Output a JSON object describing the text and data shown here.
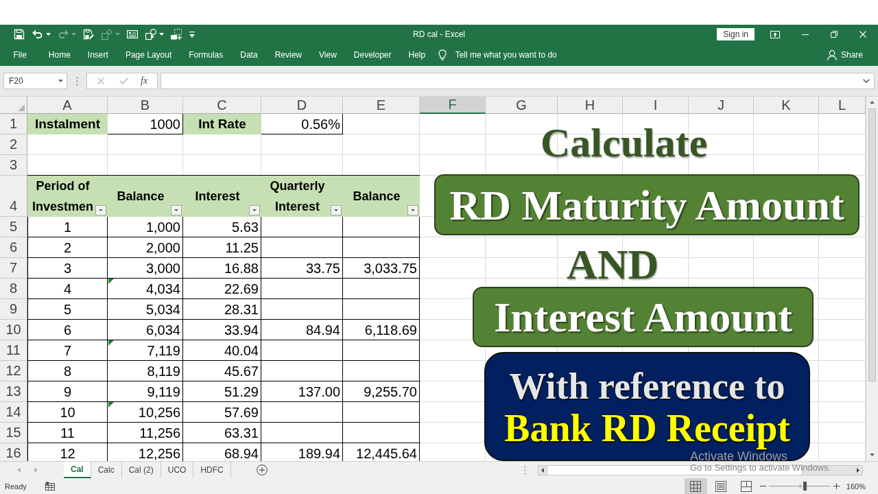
{
  "window": {
    "title": "RD cal - Excel",
    "sign_in": "Sign in"
  },
  "quick_access": [
    {
      "kind": "save",
      "disabled": false,
      "dropdown": false
    },
    {
      "kind": "undo",
      "disabled": false,
      "dropdown": true
    },
    {
      "kind": "redo",
      "disabled": true,
      "dropdown": true
    },
    {
      "kind": "save_edit",
      "disabled": false,
      "dropdown": false
    },
    {
      "kind": "shape_select",
      "disabled": true,
      "dropdown": true
    },
    {
      "kind": "form",
      "disabled": false,
      "dropdown": false
    },
    {
      "kind": "shapes",
      "disabled": false,
      "dropdown": true
    },
    {
      "kind": "screenshot",
      "disabled": false,
      "dropdown": false
    },
    {
      "kind": "customize",
      "disabled": false,
      "dropdown": false
    }
  ],
  "ribbon": {
    "tabs": [
      {
        "label": "File",
        "selected": false
      },
      {
        "label": "Home",
        "selected": false
      },
      {
        "label": "Insert",
        "selected": false
      },
      {
        "label": "Page Layout",
        "selected": false
      },
      {
        "label": "Formulas",
        "selected": false
      },
      {
        "label": "Data",
        "selected": false
      },
      {
        "label": "Review",
        "selected": false
      },
      {
        "label": "View",
        "selected": false
      },
      {
        "label": "Developer",
        "selected": false
      },
      {
        "label": "Help",
        "selected": false
      }
    ],
    "tell_me": "Tell me what you want to do",
    "share": "Share"
  },
  "formula_bar": {
    "name_box": "F20",
    "function_label": "fx"
  },
  "sheet": {
    "columns": [
      {
        "label": "A",
        "selected": false
      },
      {
        "label": "B",
        "selected": false
      },
      {
        "label": "C",
        "selected": false
      },
      {
        "label": "D",
        "selected": false
      },
      {
        "label": "E",
        "selected": false
      },
      {
        "label": "F",
        "selected": true
      },
      {
        "label": "G",
        "selected": false
      },
      {
        "label": "H",
        "selected": false
      },
      {
        "label": "I",
        "selected": false
      },
      {
        "label": "J",
        "selected": false
      },
      {
        "label": "K",
        "selected": false
      },
      {
        "label": "L",
        "selected": false
      }
    ],
    "row_headers": [
      "1",
      "2",
      "3",
      "4",
      "5",
      "6",
      "7",
      "8",
      "9",
      "10",
      "11",
      "12",
      "13",
      "14",
      "15",
      "16"
    ],
    "inputs": {
      "instalment_label": "Instalment",
      "instalment": "1000",
      "rate_label": "Int Rate",
      "rate": "0.56%"
    },
    "table": {
      "headers": [
        "Period of Investmen",
        "Balance",
        "Interest",
        "Quarterly Interest",
        "Balance"
      ],
      "rows": [
        {
          "period": "1",
          "balance": "1,000",
          "interest": "5.63",
          "flagged": false
        },
        {
          "period": "2",
          "balance": "2,000",
          "interest": "11.25",
          "flagged": false
        },
        {
          "period": "3",
          "balance": "3,000",
          "interest": "16.88",
          "quarterly_interest": "33.75",
          "quarter_balance": "3,033.75",
          "flagged": false
        },
        {
          "period": "4",
          "balance": "4,034",
          "interest": "22.69",
          "flagged": true
        },
        {
          "period": "5",
          "balance": "5,034",
          "interest": "28.31",
          "flagged": false
        },
        {
          "period": "6",
          "balance": "6,034",
          "interest": "33.94",
          "quarterly_interest": "84.94",
          "quarter_balance": "6,118.69",
          "flagged": false
        },
        {
          "period": "7",
          "balance": "7,119",
          "interest": "40.04",
          "flagged": true
        },
        {
          "period": "8",
          "balance": "8,119",
          "interest": "45.67",
          "flagged": false
        },
        {
          "period": "9",
          "balance": "9,119",
          "interest": "51.29",
          "quarterly_interest": "137.00",
          "quarter_balance": "9,255.70",
          "flagged": false
        },
        {
          "period": "10",
          "balance": "10,256",
          "interest": "57.69",
          "flagged": true
        },
        {
          "period": "11",
          "balance": "11,256",
          "interest": "63.31",
          "flagged": false
        },
        {
          "period": "12",
          "balance": "12,256",
          "interest": "68.94",
          "quarterly_interest": "189.94",
          "quarter_balance": "12,445.64",
          "flagged": false
        }
      ]
    }
  },
  "shapes": [
    {
      "kind": "wordart",
      "text": "Calculate"
    },
    {
      "kind": "banner",
      "text": "RD Maturity Amount"
    },
    {
      "kind": "wordart",
      "text": "AND"
    },
    {
      "kind": "banner",
      "text": "Interest Amount"
    },
    {
      "kind": "panel",
      "lines": [
        "With reference to",
        "Bank RD Receipt"
      ]
    }
  ],
  "sheet_tabs": [
    {
      "label": "Cal",
      "selected": true
    },
    {
      "label": "Calc",
      "selected": false
    },
    {
      "label": "Cal (2)",
      "selected": false
    },
    {
      "label": "UCO",
      "selected": false
    },
    {
      "label": "HDFC",
      "selected": false
    }
  ],
  "status_bar": {
    "mode": "Ready",
    "views": [
      {
        "kind": "normal",
        "selected": true
      },
      {
        "kind": "page_layout",
        "selected": false
      },
      {
        "kind": "page_break_preview",
        "selected": false
      }
    ],
    "zoom": {
      "level": 0.59,
      "reading": "160%"
    }
  },
  "activation_notice": {
    "title": "Activate Windows",
    "hint": "Go to Settings to activate Windows."
  }
}
